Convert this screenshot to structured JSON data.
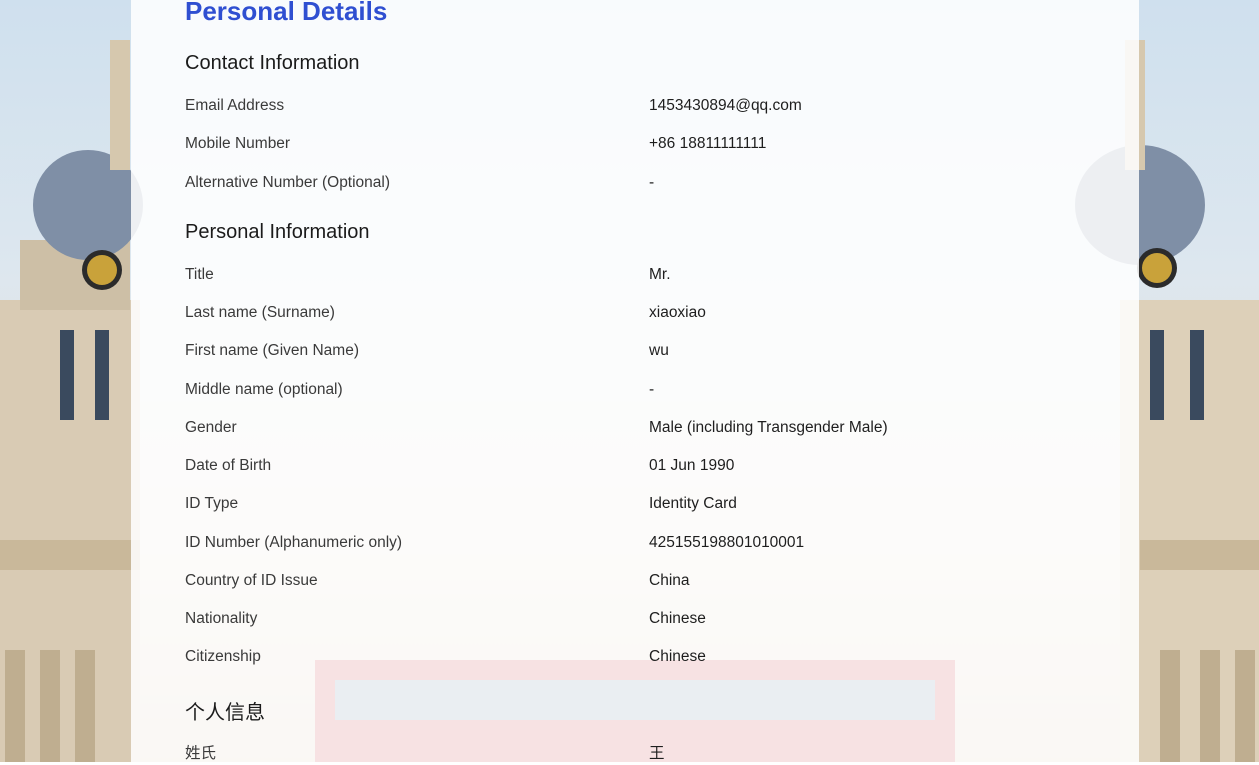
{
  "page": {
    "title": "Personal Details"
  },
  "contact": {
    "heading": "Contact Information",
    "rows": [
      {
        "label": "Email Address",
        "value": "1453430894@qq.com"
      },
      {
        "label": "Mobile Number",
        "value": "+86 18811111111"
      },
      {
        "label": "Alternative Number (Optional)",
        "value": "-"
      }
    ]
  },
  "personal": {
    "heading": "Personal Information",
    "rows": [
      {
        "label": "Title",
        "value": "Mr."
      },
      {
        "label": "Last name (Surname)",
        "value": "xiaoxiao"
      },
      {
        "label": "First name (Given Name)",
        "value": "wu"
      },
      {
        "label": "Middle name (optional)",
        "value": "-"
      },
      {
        "label": "Gender",
        "value": "Male (including Transgender Male)"
      },
      {
        "label": "Date of Birth",
        "value": "01 Jun 1990"
      },
      {
        "label": "ID Type",
        "value": "Identity Card"
      },
      {
        "label": "ID Number (Alphanumeric only)",
        "value": "425155198801010001"
      },
      {
        "label": "Country of ID Issue",
        "value": "China"
      },
      {
        "label": "Nationality",
        "value": "Chinese"
      },
      {
        "label": "Citizenship",
        "value": "Chinese"
      }
    ]
  },
  "chinese": {
    "heading": "个人信息",
    "rows": [
      {
        "label": "姓氏",
        "value": "王"
      }
    ]
  },
  "colors": {
    "title_accent": "#2f4fd1",
    "panel_background": "rgba(255,255,255,0.86)"
  }
}
